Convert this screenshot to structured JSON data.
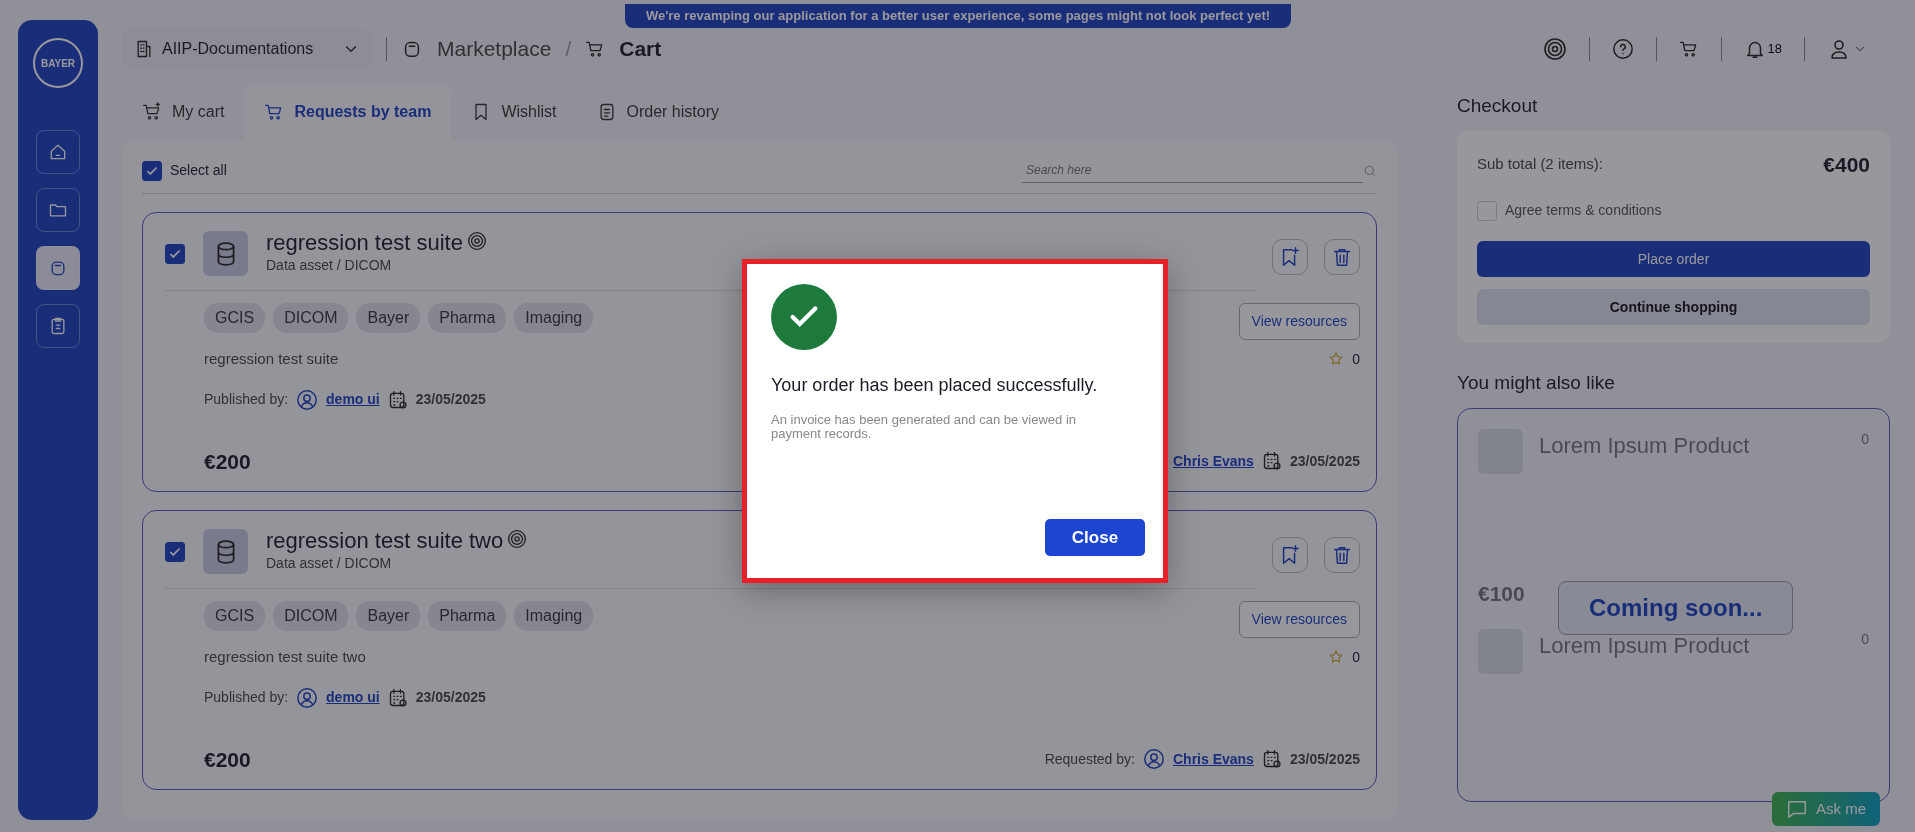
{
  "banner": "We're revamping our application for a better user experience, some pages might not look perfect yet!",
  "logo": "BAYER",
  "workspace": "AIIP-Documentations",
  "breadcrumb": [
    "Marketplace",
    "/",
    "Cart"
  ],
  "notifications_count": "18",
  "tabs": [
    {
      "label": "My cart",
      "selected": false,
      "kind": "cart-plus"
    },
    {
      "label": "Requests by team",
      "selected": true,
      "kind": "cart"
    },
    {
      "label": "Wishlist",
      "selected": false,
      "kind": "bookmark"
    },
    {
      "label": "Order history",
      "selected": false,
      "kind": "document"
    }
  ],
  "select_all": {
    "label": "Select all",
    "checked": true
  },
  "search": {
    "placeholder": "Search here"
  },
  "items": [
    {
      "checked": true,
      "title": "regression test suite",
      "subtitle": "Data asset / DICOM",
      "tags": [
        "GCIS",
        "DICOM",
        "Bayer",
        "Pharma",
        "Imaging"
      ],
      "description": "regression test suite",
      "published_label": "Published by:",
      "publisher": "demo ui",
      "published_date": "23/05/2025",
      "price": "€200",
      "rating": "0",
      "view_button": "View resources",
      "requester": "Chris Evans",
      "requested_date": "23/05/2025"
    },
    {
      "checked": true,
      "title": "regression test suite two",
      "subtitle": "Data asset / DICOM",
      "tags": [
        "GCIS",
        "DICOM",
        "Bayer",
        "Pharma",
        "Imaging"
      ],
      "description": "regression test suite two",
      "published_label": "Published by:",
      "publisher": "demo ui",
      "published_date": "23/05/2025",
      "price": "€200",
      "rating": "0",
      "view_button": "View resources",
      "requested_label": "Requested by:",
      "requester": "Chris Evans",
      "requested_date": "23/05/2025"
    }
  ],
  "checkout": {
    "title": "Checkout",
    "subtotal_label": "Sub total (2 items):",
    "subtotal": "€400",
    "terms_label": "Agree terms & conditions",
    "terms_checked": false,
    "place_order": "Place order",
    "continue": "Continue shopping"
  },
  "suggestions": {
    "title": "You might also like",
    "overlay": "Coming soon...",
    "products": [
      {
        "title": "Lorem Ipsum Product",
        "count": "0",
        "price": "€100"
      },
      {
        "title": "Lorem Ipsum Product",
        "count": "0"
      }
    ]
  },
  "chat_button": "Ask me",
  "modal": {
    "message": "Your order has been placed successfully.",
    "detail": "An invoice has been generated and can be viewed in payment records.",
    "close": "Close"
  }
}
